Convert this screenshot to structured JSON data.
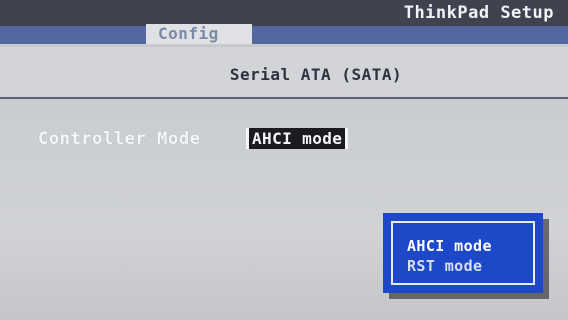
{
  "app": {
    "title": "ThinkPad Setup"
  },
  "tabs": [
    {
      "label": "Config",
      "active": true
    }
  ],
  "section": {
    "title": "Serial ATA (SATA)"
  },
  "settings": [
    {
      "label": "Controller Mode",
      "value": "AHCI mode"
    }
  ],
  "popup": {
    "options": [
      {
        "label": "AHCI mode",
        "highlighted": true
      },
      {
        "label": "RST mode",
        "highlighted": false
      }
    ]
  },
  "colors": {
    "header_background": "#3f4350",
    "tab_bar": "#54679f",
    "panel_background": "#cfd2d6",
    "popup_background": "#1d49c8",
    "selected_value_background": "#1a1c22"
  }
}
